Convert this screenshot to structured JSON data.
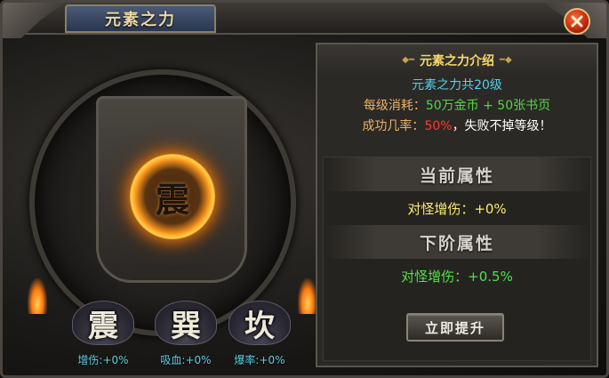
{
  "window": {
    "title": "元素之力"
  },
  "altar": {
    "core_element": "震"
  },
  "elements": [
    {
      "char": "震",
      "stat": "增伤:+0%"
    },
    {
      "char": "巽",
      "stat": "吸血:+0%"
    },
    {
      "char": "坎",
      "stat": "爆率:+0%"
    }
  ],
  "intro": {
    "title": "元素之力介绍",
    "levels_line": "元素之力共20级",
    "cost_label": "每级消耗：",
    "cost_value": "50万金币 + 50张书页",
    "rate_label": "成功几率：",
    "rate_value": "50%",
    "rate_suffix": "，失败不掉等级！"
  },
  "current": {
    "heading": "当前属性",
    "stat": "对怪增伤：+0%"
  },
  "next": {
    "heading": "下阶属性",
    "stat": "对怪增伤：+0.5%"
  },
  "buttons": {
    "upgrade": "立即提升"
  },
  "colors": {
    "title_gold": "#ead7a2",
    "cyan": "#56cfe6",
    "green": "#55d44a",
    "red": "#ff3a2e",
    "yellow": "#f7ed72",
    "orange_glow": "#ff8a10"
  }
}
